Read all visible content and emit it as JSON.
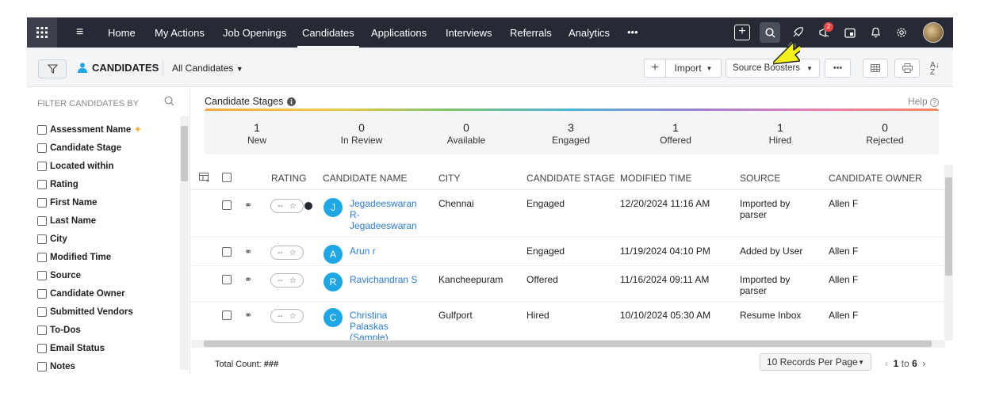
{
  "nav": {
    "items": [
      "Home",
      "My Actions",
      "Job Openings",
      "Candidates",
      "Applications",
      "Interviews",
      "Referrals",
      "Analytics"
    ],
    "more": "•••",
    "notification_count": "2"
  },
  "toolbar": {
    "title": "CANDIDATES",
    "view_label": "All Candidates",
    "import_label": "Import",
    "source_boosters_label": "Source Boosters",
    "more_label": "•••",
    "sort_label": "A↓Z"
  },
  "filter": {
    "header": "FILTER CANDIDATES BY",
    "items": [
      "Assessment Name",
      "Candidate Stage",
      "Located within",
      "Rating",
      "First Name",
      "Last Name",
      "City",
      "Modified Time",
      "Source",
      "Candidate Owner",
      "Submitted Vendors",
      "To-Dos",
      "Email Status",
      "Notes"
    ]
  },
  "stages": {
    "title": "Candidate Stages",
    "help": "Help",
    "items": [
      {
        "count": "1",
        "label": "New"
      },
      {
        "count": "0",
        "label": "In Review"
      },
      {
        "count": "0",
        "label": "Available"
      },
      {
        "count": "3",
        "label": "Engaged"
      },
      {
        "count": "1",
        "label": "Offered"
      },
      {
        "count": "1",
        "label": "Hired"
      },
      {
        "count": "0",
        "label": "Rejected"
      }
    ]
  },
  "table": {
    "columns": [
      "RATING",
      "CANDIDATE NAME",
      "CITY",
      "CANDIDATE STAGE",
      "MODIFIED TIME",
      "SOURCE",
      "CANDIDATE OWNER"
    ],
    "rows": [
      {
        "initial": "J",
        "name": "Jegadeeswaran R-Jegadeeswaran",
        "city": "Chennai",
        "stage": "Engaged",
        "modified": "12/20/2024 11:16 AM",
        "source": "Imported by parser",
        "owner": "Allen F",
        "rating": "--"
      },
      {
        "initial": "A",
        "name": "Arun r",
        "city": "",
        "stage": "Engaged",
        "modified": "11/19/2024 04:10 PM",
        "source": "Added by User",
        "owner": "Allen F",
        "rating": "--"
      },
      {
        "initial": "R",
        "name": "Ravichandran S",
        "city": "Kancheepuram",
        "stage": "Offered",
        "modified": "11/16/2024 09:11 AM",
        "source": "Imported by parser",
        "owner": "Allen F",
        "rating": "--"
      },
      {
        "initial": "C",
        "name": "Christina Palaskas (Sample)",
        "city": "Gulfport",
        "stage": "Hired",
        "modified": "10/10/2024 05:30 AM",
        "source": "Resume Inbox",
        "owner": "Allen F",
        "rating": "--"
      }
    ]
  },
  "footer": {
    "total_label": "Total Count:",
    "total_value": "###",
    "per_page": "10 Records Per Page",
    "page_from": "1",
    "page_to_label": "to",
    "page_to": "6"
  },
  "colors": {
    "nav_bg": "#262a35",
    "link": "#2b7bd6",
    "avatar": "#1ea7e4",
    "cursor": "#f5ef1a"
  }
}
